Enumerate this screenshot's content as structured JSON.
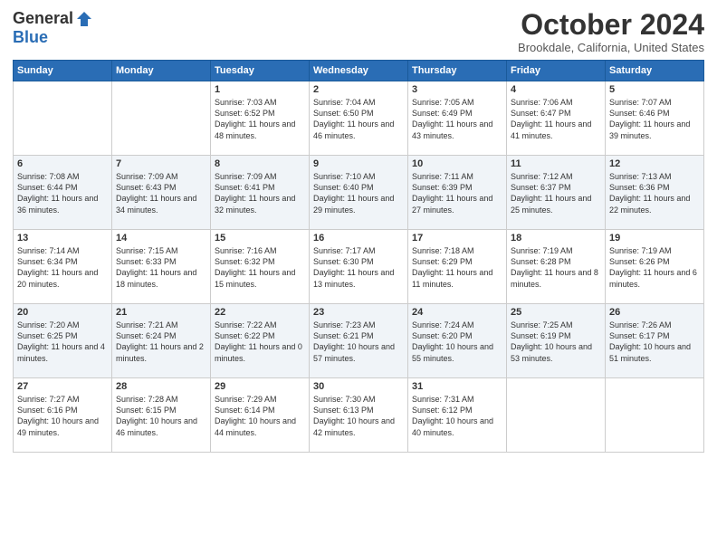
{
  "logo": {
    "general": "General",
    "blue": "Blue"
  },
  "title": {
    "month": "October 2024",
    "location": "Brookdale, California, United States"
  },
  "headers": [
    "Sunday",
    "Monday",
    "Tuesday",
    "Wednesday",
    "Thursday",
    "Friday",
    "Saturday"
  ],
  "weeks": [
    [
      {
        "day": "",
        "info": ""
      },
      {
        "day": "",
        "info": ""
      },
      {
        "day": "1",
        "info": "Sunrise: 7:03 AM\nSunset: 6:52 PM\nDaylight: 11 hours and 48 minutes."
      },
      {
        "day": "2",
        "info": "Sunrise: 7:04 AM\nSunset: 6:50 PM\nDaylight: 11 hours and 46 minutes."
      },
      {
        "day": "3",
        "info": "Sunrise: 7:05 AM\nSunset: 6:49 PM\nDaylight: 11 hours and 43 minutes."
      },
      {
        "day": "4",
        "info": "Sunrise: 7:06 AM\nSunset: 6:47 PM\nDaylight: 11 hours and 41 minutes."
      },
      {
        "day": "5",
        "info": "Sunrise: 7:07 AM\nSunset: 6:46 PM\nDaylight: 11 hours and 39 minutes."
      }
    ],
    [
      {
        "day": "6",
        "info": "Sunrise: 7:08 AM\nSunset: 6:44 PM\nDaylight: 11 hours and 36 minutes."
      },
      {
        "day": "7",
        "info": "Sunrise: 7:09 AM\nSunset: 6:43 PM\nDaylight: 11 hours and 34 minutes."
      },
      {
        "day": "8",
        "info": "Sunrise: 7:09 AM\nSunset: 6:41 PM\nDaylight: 11 hours and 32 minutes."
      },
      {
        "day": "9",
        "info": "Sunrise: 7:10 AM\nSunset: 6:40 PM\nDaylight: 11 hours and 29 minutes."
      },
      {
        "day": "10",
        "info": "Sunrise: 7:11 AM\nSunset: 6:39 PM\nDaylight: 11 hours and 27 minutes."
      },
      {
        "day": "11",
        "info": "Sunrise: 7:12 AM\nSunset: 6:37 PM\nDaylight: 11 hours and 25 minutes."
      },
      {
        "day": "12",
        "info": "Sunrise: 7:13 AM\nSunset: 6:36 PM\nDaylight: 11 hours and 22 minutes."
      }
    ],
    [
      {
        "day": "13",
        "info": "Sunrise: 7:14 AM\nSunset: 6:34 PM\nDaylight: 11 hours and 20 minutes."
      },
      {
        "day": "14",
        "info": "Sunrise: 7:15 AM\nSunset: 6:33 PM\nDaylight: 11 hours and 18 minutes."
      },
      {
        "day": "15",
        "info": "Sunrise: 7:16 AM\nSunset: 6:32 PM\nDaylight: 11 hours and 15 minutes."
      },
      {
        "day": "16",
        "info": "Sunrise: 7:17 AM\nSunset: 6:30 PM\nDaylight: 11 hours and 13 minutes."
      },
      {
        "day": "17",
        "info": "Sunrise: 7:18 AM\nSunset: 6:29 PM\nDaylight: 11 hours and 11 minutes."
      },
      {
        "day": "18",
        "info": "Sunrise: 7:19 AM\nSunset: 6:28 PM\nDaylight: 11 hours and 8 minutes."
      },
      {
        "day": "19",
        "info": "Sunrise: 7:19 AM\nSunset: 6:26 PM\nDaylight: 11 hours and 6 minutes."
      }
    ],
    [
      {
        "day": "20",
        "info": "Sunrise: 7:20 AM\nSunset: 6:25 PM\nDaylight: 11 hours and 4 minutes."
      },
      {
        "day": "21",
        "info": "Sunrise: 7:21 AM\nSunset: 6:24 PM\nDaylight: 11 hours and 2 minutes."
      },
      {
        "day": "22",
        "info": "Sunrise: 7:22 AM\nSunset: 6:22 PM\nDaylight: 11 hours and 0 minutes."
      },
      {
        "day": "23",
        "info": "Sunrise: 7:23 AM\nSunset: 6:21 PM\nDaylight: 10 hours and 57 minutes."
      },
      {
        "day": "24",
        "info": "Sunrise: 7:24 AM\nSunset: 6:20 PM\nDaylight: 10 hours and 55 minutes."
      },
      {
        "day": "25",
        "info": "Sunrise: 7:25 AM\nSunset: 6:19 PM\nDaylight: 10 hours and 53 minutes."
      },
      {
        "day": "26",
        "info": "Sunrise: 7:26 AM\nSunset: 6:17 PM\nDaylight: 10 hours and 51 minutes."
      }
    ],
    [
      {
        "day": "27",
        "info": "Sunrise: 7:27 AM\nSunset: 6:16 PM\nDaylight: 10 hours and 49 minutes."
      },
      {
        "day": "28",
        "info": "Sunrise: 7:28 AM\nSunset: 6:15 PM\nDaylight: 10 hours and 46 minutes."
      },
      {
        "day": "29",
        "info": "Sunrise: 7:29 AM\nSunset: 6:14 PM\nDaylight: 10 hours and 44 minutes."
      },
      {
        "day": "30",
        "info": "Sunrise: 7:30 AM\nSunset: 6:13 PM\nDaylight: 10 hours and 42 minutes."
      },
      {
        "day": "31",
        "info": "Sunrise: 7:31 AM\nSunset: 6:12 PM\nDaylight: 10 hours and 40 minutes."
      },
      {
        "day": "",
        "info": ""
      },
      {
        "day": "",
        "info": ""
      }
    ]
  ]
}
